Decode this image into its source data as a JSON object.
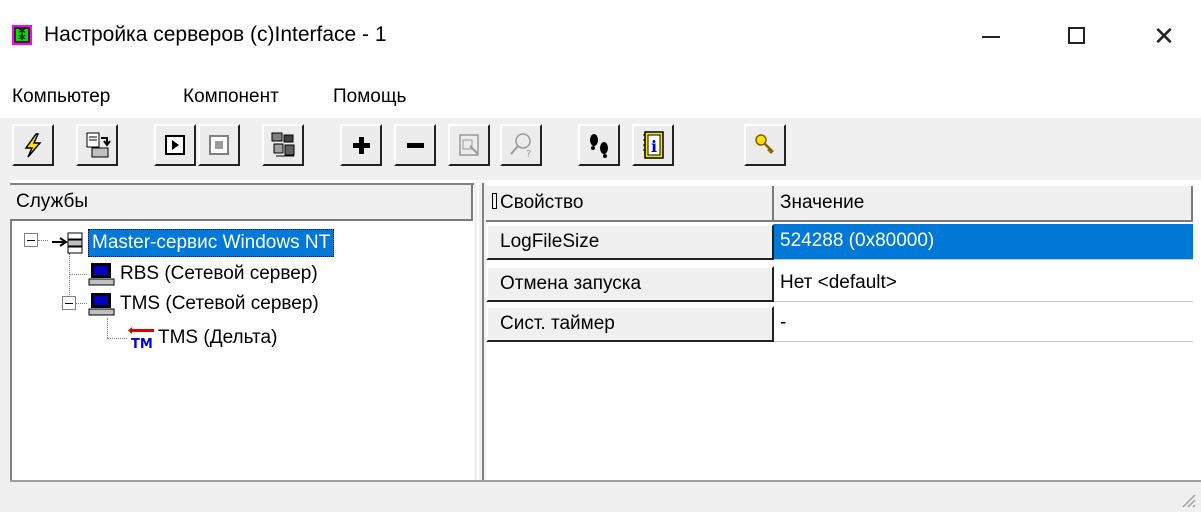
{
  "window": {
    "title": "Настройка серверов (c)Interface - 1",
    "icon": "app-grid-icon",
    "icon_glyph": "⁑",
    "close_glyph": "✕"
  },
  "menu": [
    {
      "label": "Компьютер"
    },
    {
      "label": "Компонент"
    },
    {
      "label": "Помощь"
    }
  ],
  "toolbar": [
    {
      "name": "connect-button",
      "icon": "lightning-icon"
    },
    {
      "name": "transfer-button",
      "icon": "transfer-icon"
    },
    {
      "name": "start-button",
      "icon": "play-icon"
    },
    {
      "name": "stop-button",
      "icon": "stop-icon"
    },
    {
      "name": "components-button",
      "icon": "components-icon"
    },
    {
      "name": "add-button",
      "icon": "plus-icon"
    },
    {
      "name": "remove-button",
      "icon": "minus-icon"
    },
    {
      "name": "properties-button",
      "icon": "properties-icon",
      "disabled": true
    },
    {
      "name": "find-button",
      "icon": "find-help-icon",
      "disabled": true
    },
    {
      "name": "footsteps-button",
      "icon": "footsteps-icon"
    },
    {
      "name": "info-button",
      "icon": "info-icon"
    },
    {
      "name": "key-button",
      "icon": "key-icon"
    }
  ],
  "tree": {
    "header": "Службы",
    "nodes": [
      {
        "label": "Master-сервис Windows NT",
        "icon": "network-icon",
        "selected": true,
        "expanded": true
      },
      {
        "label": "RBS (Сетевой сервер)",
        "icon": "computer-icon"
      },
      {
        "label": "TMS (Сетевой сервер)",
        "icon": "computer-icon",
        "expanded": true
      },
      {
        "label": "TMS (Дельта)",
        "icon": "tm-icon"
      }
    ]
  },
  "grid": {
    "headers": {
      "property": "Свойство",
      "value": "Значение"
    },
    "rows": [
      {
        "property": "LogFileSize",
        "value": "524288 (0x80000)",
        "selected": true
      },
      {
        "property": "Отмена запуска",
        "value": "Нет <default>"
      },
      {
        "property": "Сист. таймер",
        "value": "-"
      }
    ]
  },
  "colors": {
    "selection": "#0078d7",
    "face": "#f0f0f0",
    "tm_red": "#e00000",
    "tm_blue": "#0000e0"
  }
}
